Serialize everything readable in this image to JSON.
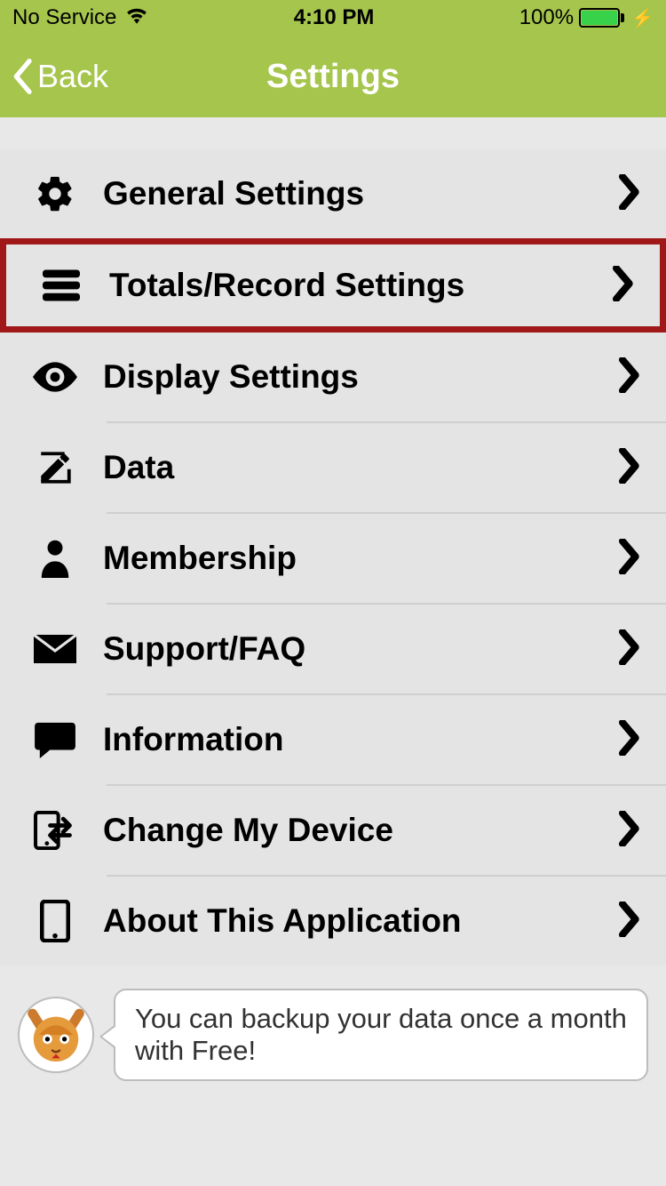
{
  "status": {
    "carrier": "No Service",
    "time": "4:10 PM",
    "battery_pct": "100%"
  },
  "nav": {
    "back_label": "Back",
    "title": "Settings"
  },
  "menu": {
    "items": [
      {
        "icon": "gear-icon",
        "label": "General Settings"
      },
      {
        "icon": "list-icon",
        "label": "Totals/Record Settings",
        "highlighted": true
      },
      {
        "icon": "eye-icon",
        "label": "Display Settings"
      },
      {
        "icon": "edit-icon",
        "label": "Data"
      },
      {
        "icon": "person-icon",
        "label": "Membership"
      },
      {
        "icon": "mail-icon",
        "label": "Support/FAQ"
      },
      {
        "icon": "chat-icon",
        "label": "Information"
      },
      {
        "icon": "transfer-icon",
        "label": "Change My Device"
      },
      {
        "icon": "device-icon",
        "label": "About This Application"
      }
    ]
  },
  "tip": {
    "text": "You can backup your data once a month with Free!"
  }
}
